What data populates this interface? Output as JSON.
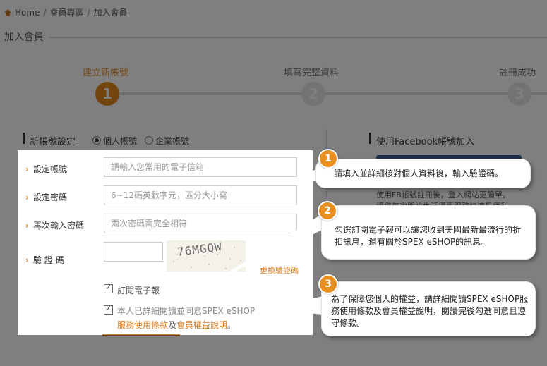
{
  "breadcrumb": {
    "home": "Home",
    "sep": "/",
    "members": "會員專區",
    "join": "加入會員"
  },
  "page_title": "加入會員",
  "steps": [
    {
      "label": "建立新帳號",
      "number": "1",
      "state": "active"
    },
    {
      "label": "填寫完整資料",
      "number": "2",
      "state": "inactive"
    },
    {
      "label": "註冊成功",
      "number": "3",
      "state": "inactive"
    }
  ],
  "account_type": {
    "title": "新帳號設定",
    "personal": "個人帳號",
    "business": "企業帳號",
    "selected": "personal"
  },
  "facebook": {
    "title": "使用Facebook帳號加入",
    "note1": "使用FB帳號註冊後，登入網站更簡單。",
    "note2": "讓您每次開始生活優惠服務快速又便利。"
  },
  "form": {
    "account_label": "設定帳號",
    "account_placeholder": "請輸入您常用的電子信箱",
    "password_label": "設定密碼",
    "password_placeholder": "6~12碼英數字元，區分大小寫",
    "password2_label": "再次輸入密碼",
    "password2_placeholder": "兩次密碼需完全相符",
    "captcha_label": "驗 證 碼",
    "captcha_value": "",
    "captcha_text": "76MGQW",
    "captcha_refresh": "更換驗證碼",
    "subscribe_label": "訂閱電子報",
    "subscribe_checked": true,
    "terms_label": "本人已詳細閱讀並同意SPEX eSHOP",
    "terms_checked": true,
    "terms_link1": "服務使用條款",
    "terms_and": "及",
    "terms_link2": "會員權益說明",
    "terms_end": "。"
  },
  "callouts": [
    {
      "number": "1",
      "text": "請填入並詳細核對個人資料後，輸入驗證碼。"
    },
    {
      "number": "2",
      "text": "勾選訂閱電子報可以讓您收到美國最新最流行的折扣訊息，還有關於SPEX eSHOP的訊息。"
    },
    {
      "number": "3",
      "text": "為了保障您個人的權益，請詳細閱讀SPEX eSHOP服務使用條款及會員權益說明，閱讀完後勾選同意且遵守條款。"
    }
  ],
  "colors": {
    "accent": "#e48b1c",
    "facebook": "#3b5998"
  }
}
